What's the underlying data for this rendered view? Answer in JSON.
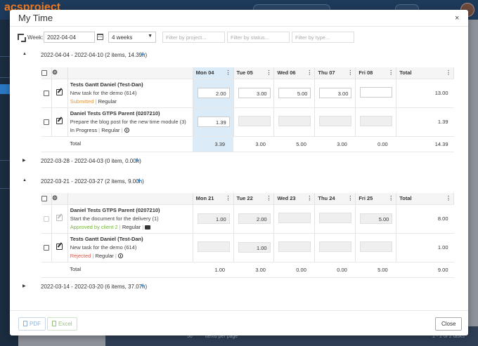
{
  "app": {
    "logo_text": "acsproject",
    "pager_text": "items per page",
    "pager_size": "50",
    "pager_summary": "1 - 2 of 2 tasks"
  },
  "modal": {
    "title": "My Time",
    "close_symbol": "×"
  },
  "toolbar": {
    "week_label": "Week:",
    "week_value": "2022-04-04",
    "weeks_select_value": "4 weeks",
    "filter_project_placeholder": "Filter by project...",
    "filter_status_placeholder": "Filter by status...",
    "filter_type_placeholder": "Filter by type..."
  },
  "groups": [
    {
      "range_label": "2022-04-04 - 2022-04-10 (2 items, 14.39h)",
      "expanded": true,
      "days": [
        "Mon 04",
        "Tue 05",
        "Wed 06",
        "Thu 07",
        "Fri 08"
      ],
      "total_header": "Total",
      "rows": [
        {
          "title": "Tests Gantt Daniel (Test-Dan)",
          "task": "New task for the demo (614)",
          "status": "Submitted",
          "status_color": "#e3953a",
          "type": "Regular",
          "sep": "|",
          "hours": [
            "2.00",
            "3.00",
            "5.00",
            "3.00",
            ""
          ],
          "total": "13.00"
        },
        {
          "title": "Daniel Tests GTPS Parent (0207210)",
          "task": "Prepare the blog post for the new time module (3)",
          "status": "In Progress",
          "status_color": "#444444",
          "type": "Regular",
          "sep": "|",
          "hours": [
            "1.39",
            "",
            "",
            "",
            ""
          ],
          "total": "1.39"
        }
      ],
      "totals_label": "Total",
      "day_totals": [
        "3.39",
        "3.00",
        "5.00",
        "3.00",
        "0.00"
      ],
      "grand_total": "14.39"
    },
    {
      "range_label": "2022-03-28 - 2022-04-03 (0 item, 0.00h)",
      "expanded": false
    },
    {
      "range_label": "2022-03-21 - 2022-03-27 (2 items, 9.00h)",
      "expanded": true,
      "days": [
        "Mon 21",
        "Tue 22",
        "Wed 23",
        "Thu 24",
        "Fri 25"
      ],
      "total_header": "Total",
      "rows": [
        {
          "title": "Daniel Tests GTPS Parent (0207210)",
          "task": "Start the document for the delivery (1)",
          "status": "Approved by client 2",
          "status_color": "#77b340",
          "type": "Regular",
          "sep": "|",
          "hours": [
            "1.00",
            "2.00",
            "",
            "",
            "5.00"
          ],
          "total": "8.00"
        },
        {
          "title": "Tests Gantt Daniel (Test-Dan)",
          "task": "New task for the demo (614)",
          "status": "Rejected",
          "status_color": "#d9574e",
          "type": "Regular",
          "sep": "|",
          "hours": [
            "",
            "1.00",
            "",
            "",
            ""
          ],
          "total": "1.00"
        }
      ],
      "totals_label": "Total",
      "day_totals": [
        "1.00",
        "3.00",
        "0.00",
        "0.00",
        "5.00"
      ],
      "grand_total": "9.00"
    },
    {
      "range_label": "2022-03-14 - 2022-03-20 (6 items, 37.07h)",
      "expanded": false
    }
  ],
  "footer": {
    "pdf_label": "PDF",
    "excel_label": "Excel",
    "close_label": "Close"
  },
  "colors": {
    "accent": "#2a8ad8",
    "highlight_column": "#dcebf8",
    "brand_orange": "#f47b20"
  }
}
